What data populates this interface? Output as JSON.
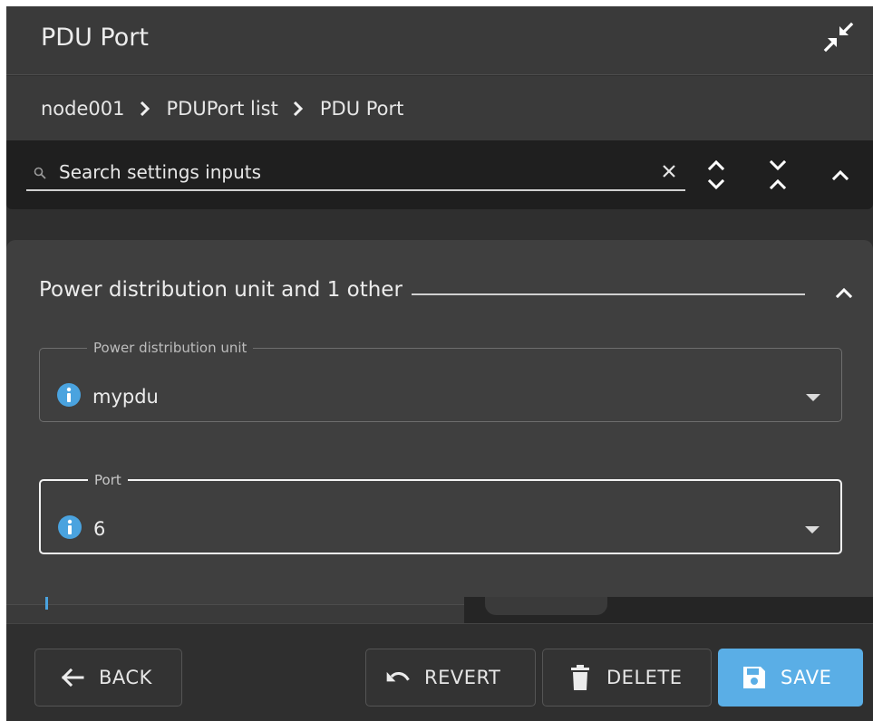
{
  "window": {
    "title": "PDU Port"
  },
  "breadcrumb": {
    "items": [
      "node001",
      "PDUPort list",
      "PDU Port"
    ]
  },
  "search": {
    "placeholder": "Search settings inputs"
  },
  "section": {
    "title": "Power distribution unit and 1 other"
  },
  "fields": [
    {
      "label": "Power distribution unit",
      "value": "mypdu"
    },
    {
      "label": "Port",
      "value": "6"
    }
  ],
  "footer": {
    "back_label": "BACK",
    "revert_label": "REVERT",
    "delete_label": "DELETE",
    "save_label": "SAVE"
  },
  "colors": {
    "accent": "#5aaee6",
    "info": "#4aa3df",
    "panel": "#3f3f3f",
    "header": "#3a3a3a",
    "searchbar": "#1f1f1f"
  },
  "icons": [
    "collapse-icon",
    "chevron-right-icon",
    "search-icon",
    "close-icon",
    "expand-all-icon",
    "collapse-all-icon",
    "chevron-up-icon",
    "info-icon",
    "dropdown-caret-icon",
    "arrow-left-icon",
    "undo-icon",
    "trash-icon",
    "save-icon"
  ]
}
